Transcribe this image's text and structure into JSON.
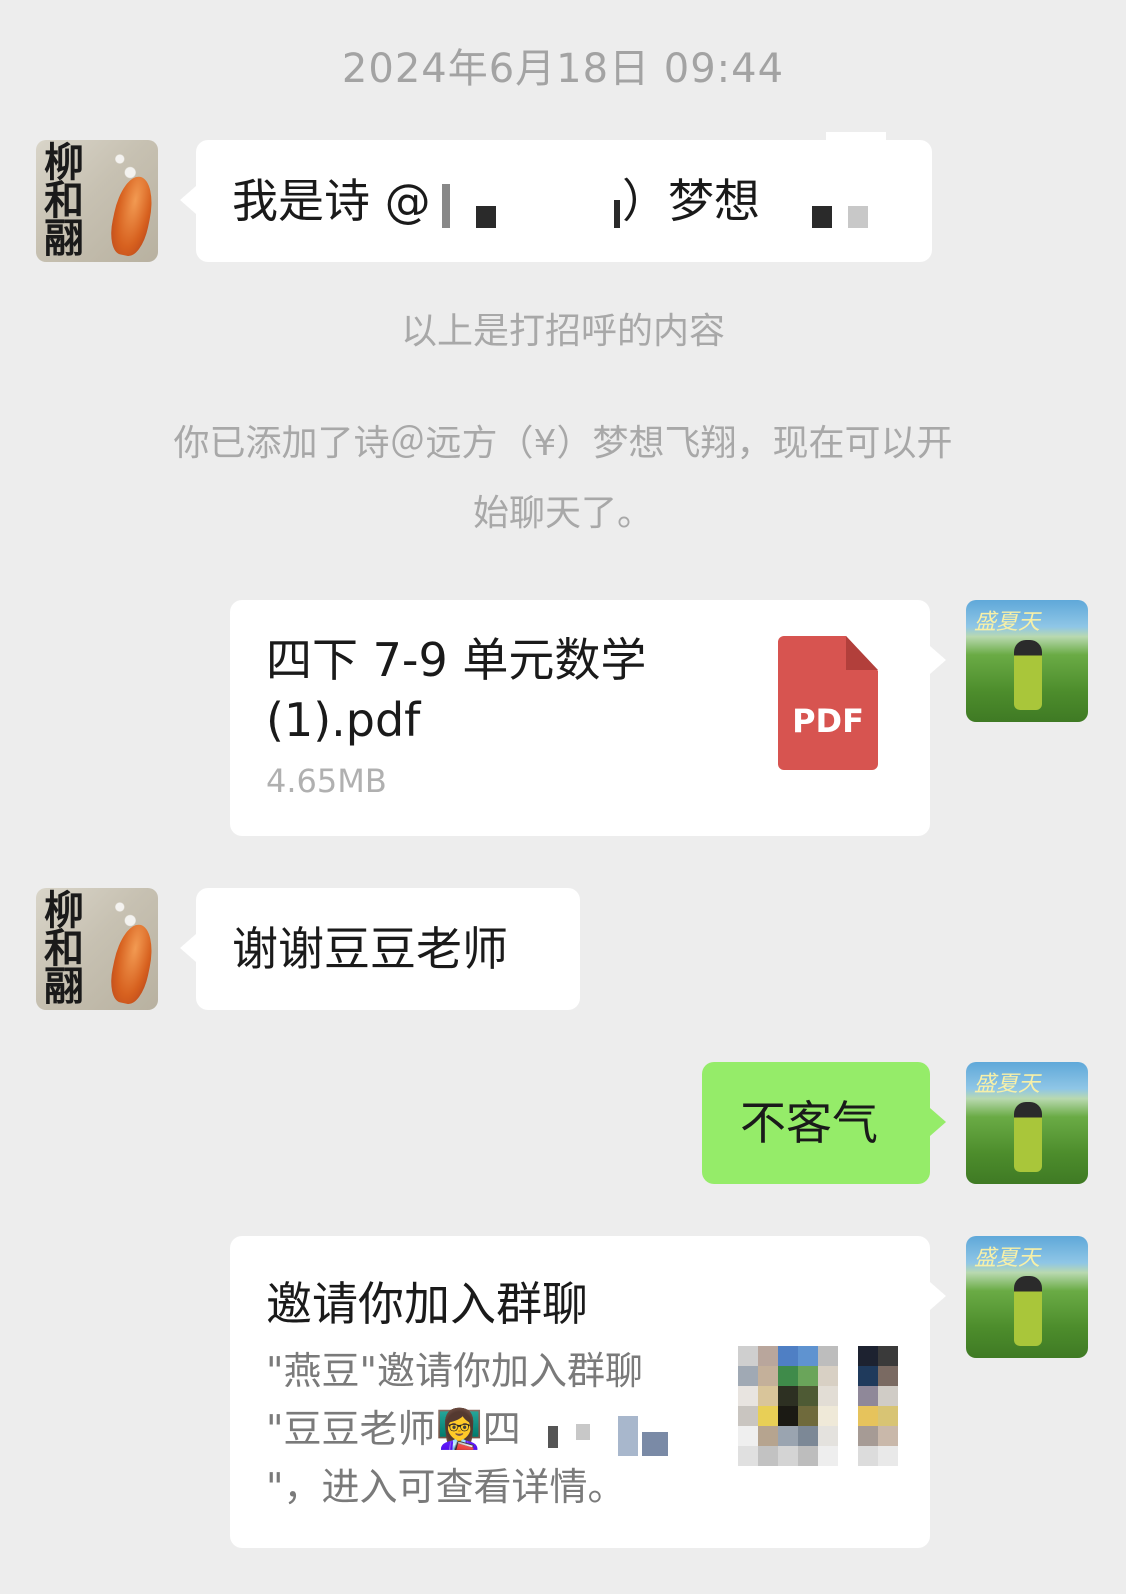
{
  "timestamp": "2024年6月18日 09:44",
  "messages": {
    "greeting": {
      "text_visible_1": "我是诗 @",
      "text_visible_2": "）梦想"
    },
    "file": {
      "name_line1": "四下 7-9 单元数学",
      "name_line2": "(1).pdf",
      "size": "4.65MB",
      "type_label": "PDF"
    },
    "thanks": {
      "text": "谢谢豆豆老师"
    },
    "reply": {
      "text": "不客气"
    },
    "invite": {
      "title": "邀请你加入群聊",
      "desc_line1": "\"燕豆\"邀请你加入群聊",
      "desc_line2": "\"豆豆老师👩‍🏫四",
      "desc_line3": "\"，进入可查看详情。"
    }
  },
  "system": {
    "greeting_note": "以上是打招呼的内容",
    "added_note_line1": "你已添加了诗＠远方（¥）梦想飞翔，现在可以开",
    "added_note_line2": "始聊天了。"
  },
  "avatars": {
    "left_calligraphy": "柳和翮",
    "right_caption": "盛夏天"
  },
  "colors": {
    "background": "#ededed",
    "bubble_self": "#95ec69",
    "bubble_other": "#ffffff",
    "pdf_red": "#d75450"
  }
}
